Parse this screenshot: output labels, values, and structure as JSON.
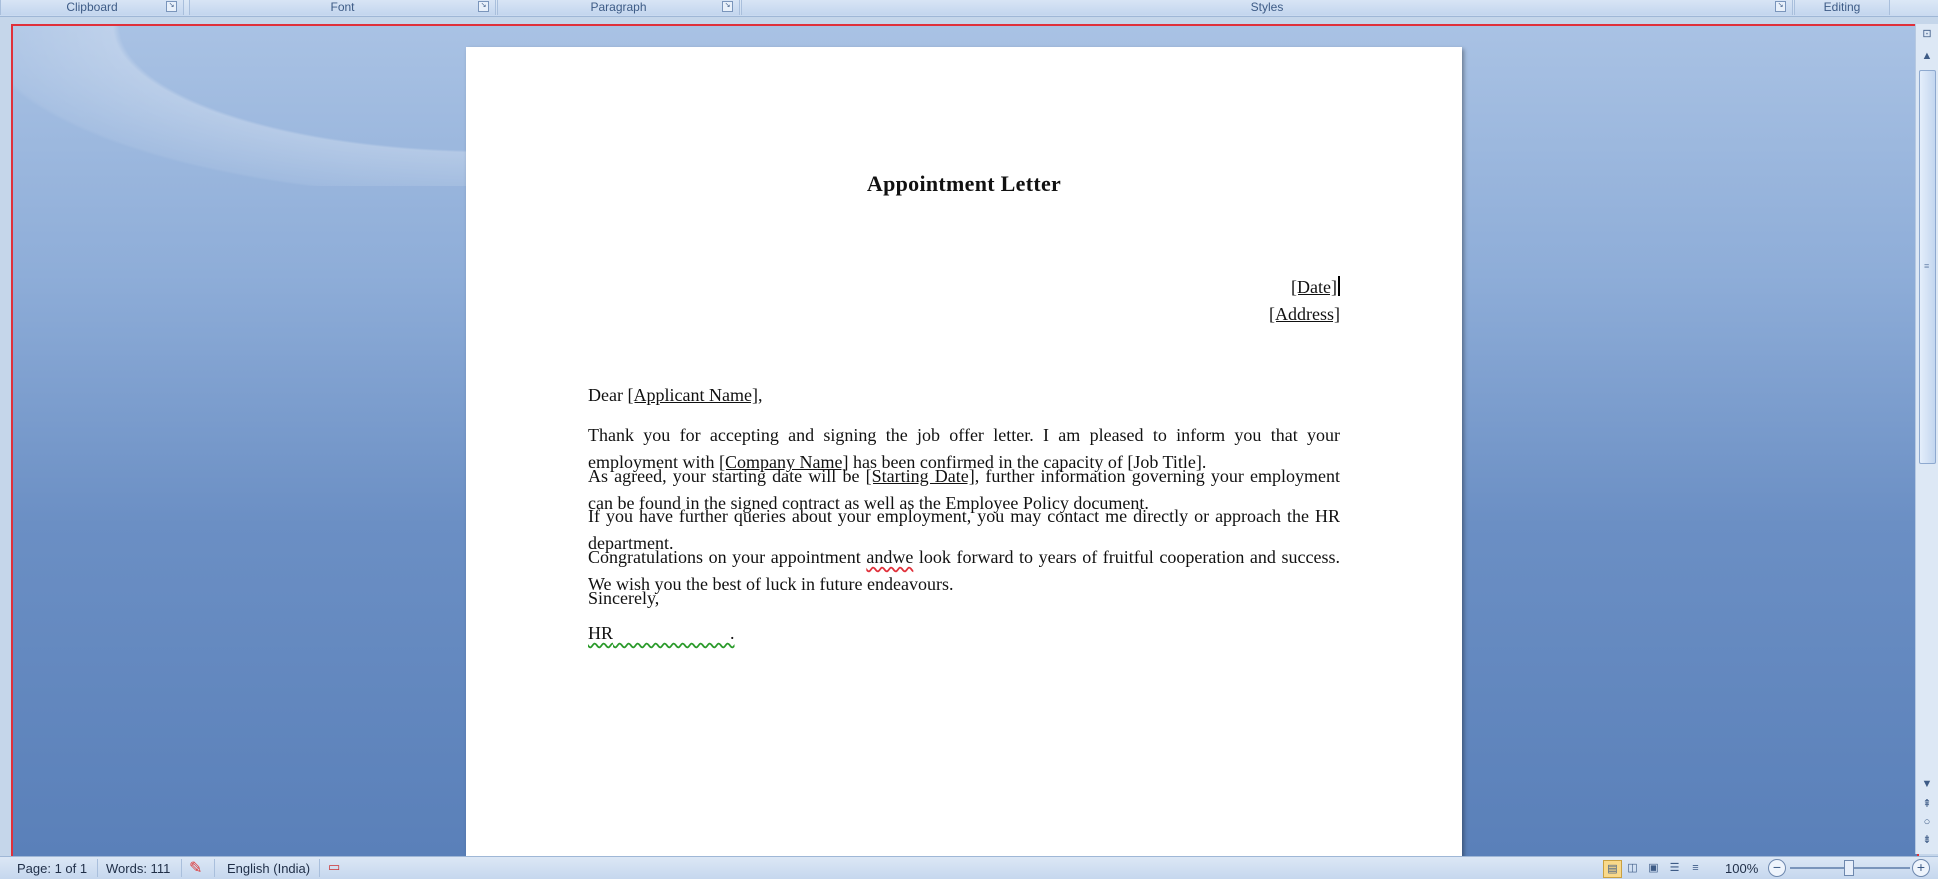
{
  "ribbon": {
    "groups": [
      {
        "label": "Clipboard"
      },
      {
        "label": "Font"
      },
      {
        "label": "Paragraph"
      },
      {
        "label": "Styles"
      },
      {
        "label": "Editing"
      }
    ]
  },
  "document": {
    "title": "Appointment Letter",
    "date": "[Date]",
    "address": "[Address]",
    "salutation_pre": "Dear ",
    "applicant": "[Applicant Name]",
    "salutation_post": ",",
    "p1_a": "Thank you for accepting and signing the job offer letter. I am pleased to inform you that your employment with ",
    "p1_company": "[Company Name]",
    "p1_b": " has been confirmed in the capacity of [Job Title].",
    "p2_a": "As agreed, your starting date will be ",
    "p2_start": "[Starting Date]",
    "p2_b": ", further information governing your employment can be found in the signed contract as well as the Employee Policy document.",
    "p3": "If you have further queries about your employment, you may contact me directly or approach the HR department.",
    "p4_a": "Congratulations on your appointment ",
    "p4_err": "andwe",
    "p4_b": " look forward to years of fruitful cooperation and success. We wish you the best of luck in future endeavours.",
    "closing": "Sincerely,",
    "signature": "HR",
    "signature_tail": "."
  },
  "statusbar": {
    "page": "Page: 1 of 1",
    "words": "Words: 111",
    "language": "English (India)",
    "zoom": "100%"
  },
  "colors": {
    "accent_border": "#e0303a",
    "doc_background": "#6b8fc4"
  }
}
